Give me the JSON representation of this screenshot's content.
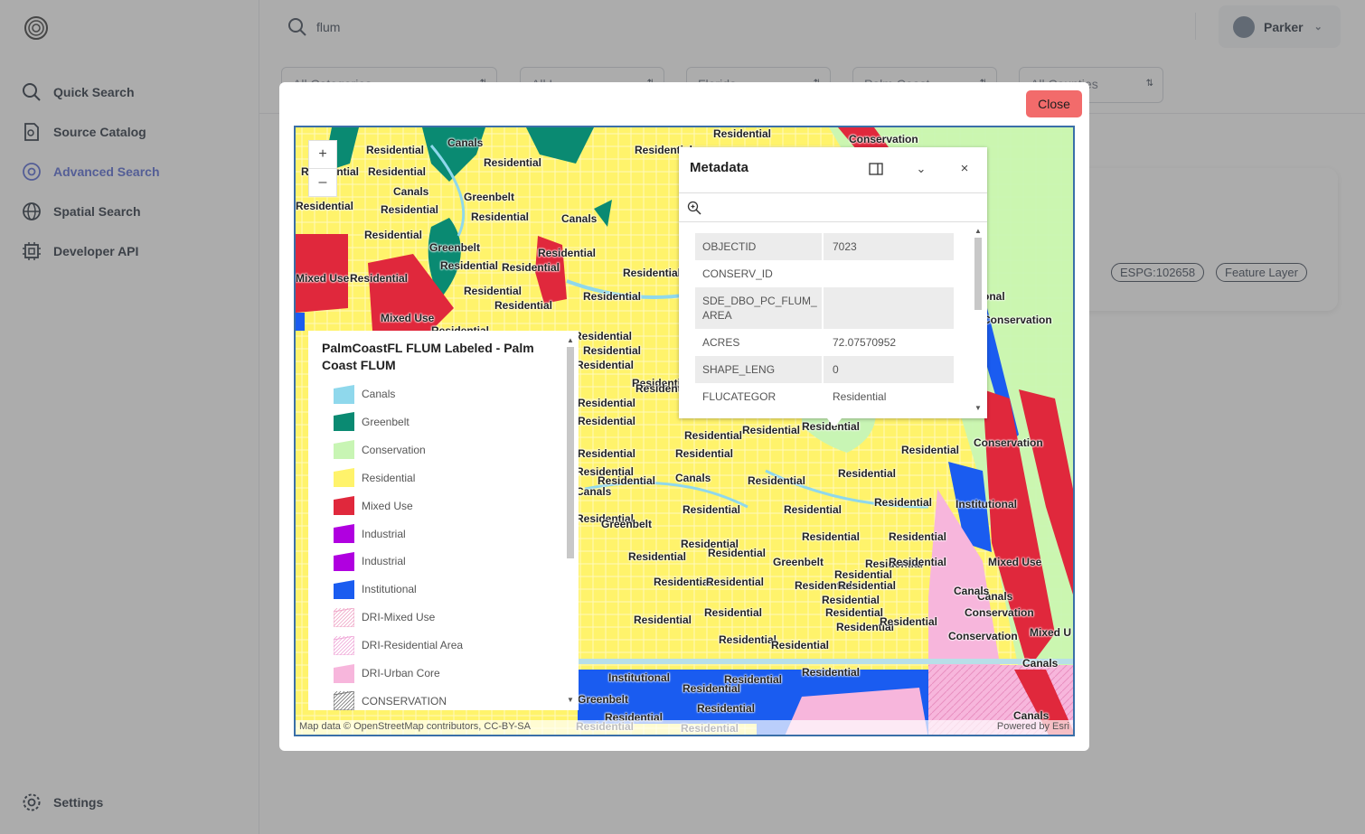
{
  "sidebar": {
    "items": [
      {
        "label": "Quick Search",
        "icon": "search-icon"
      },
      {
        "label": "Source Catalog",
        "icon": "document-icon"
      },
      {
        "label": "Advanced Search",
        "icon": "at-sign-icon",
        "active": true
      },
      {
        "label": "Spatial Search",
        "icon": "globe-icon"
      },
      {
        "label": "Developer API",
        "icon": "chip-icon"
      }
    ],
    "settings_label": "Settings"
  },
  "search": {
    "value": "flum"
  },
  "user": {
    "name": "Parker"
  },
  "filters": [
    "All Categories",
    "All L",
    "Florida",
    "Palm Coast",
    "All Counties"
  ],
  "result": {
    "tags": [
      "ESPG:102658",
      "Feature Layer"
    ]
  },
  "modal": {
    "close_label": "Close"
  },
  "map": {
    "zoom_in": "+",
    "zoom_out": "–",
    "attribution_left": "Map data © OpenStreetMap contributors, CC-BY-SA",
    "attribution_right": "Powered by Esri",
    "labels": [
      {
        "t": "Residential"
      },
      {
        "t": "Canals"
      },
      {
        "t": "Residential"
      },
      {
        "t": "Residential"
      },
      {
        "t": "Residential"
      },
      {
        "t": "Conservation"
      },
      {
        "t": "Residential"
      },
      {
        "t": "Residential"
      },
      {
        "t": "Canals"
      },
      {
        "t": "Greenbelt"
      },
      {
        "t": "Residential"
      },
      {
        "t": "Residential"
      },
      {
        "t": "Residential"
      },
      {
        "t": "Canals"
      },
      {
        "t": "Residential"
      },
      {
        "t": "Greenbelt"
      },
      {
        "t": "Residential"
      },
      {
        "t": "Residential"
      },
      {
        "t": "Residential"
      },
      {
        "t": "Residential"
      },
      {
        "t": "Mixed Use"
      },
      {
        "t": "Residential"
      },
      {
        "t": "Residential"
      },
      {
        "t": "Residential"
      },
      {
        "t": "Residential"
      },
      {
        "t": "Mixed Use"
      },
      {
        "t": "Residential"
      },
      {
        "t": "Residential"
      },
      {
        "t": "Residential"
      },
      {
        "t": "Residential"
      },
      {
        "t": "Residential"
      },
      {
        "t": "Residential"
      },
      {
        "t": "Residential"
      },
      {
        "t": "Residential"
      },
      {
        "t": "Residential"
      },
      {
        "t": "Residential"
      },
      {
        "t": "Residential"
      },
      {
        "t": "Residential"
      },
      {
        "t": "Residential"
      },
      {
        "t": "Residential"
      },
      {
        "t": "Residential"
      },
      {
        "t": "Canals"
      },
      {
        "t": "Residential"
      },
      {
        "t": "Residential"
      },
      {
        "t": "Residential"
      },
      {
        "t": "Canals"
      },
      {
        "t": "Greenbelt"
      },
      {
        "t": "Residential"
      },
      {
        "t": "Residential"
      },
      {
        "t": "Residential"
      },
      {
        "t": "Residential"
      },
      {
        "t": "Residential"
      },
      {
        "t": "Residential"
      },
      {
        "t": "Residential"
      },
      {
        "t": "Greenbelt"
      },
      {
        "t": "Residential"
      },
      {
        "t": "Residential"
      },
      {
        "t": "Residential"
      },
      {
        "t": "Residential"
      },
      {
        "t": "Residential"
      },
      {
        "t": "Residential"
      },
      {
        "t": "Residential"
      },
      {
        "t": "Residential"
      },
      {
        "t": "Residential"
      },
      {
        "t": "Residential"
      },
      {
        "t": "Residential"
      },
      {
        "t": "Residential"
      },
      {
        "t": "Residential"
      },
      {
        "t": "Residential"
      },
      {
        "t": "Institutional"
      },
      {
        "t": "Residential"
      },
      {
        "t": "Residential"
      },
      {
        "t": "Greenbelt"
      },
      {
        "t": "Residential"
      },
      {
        "t": "Residential"
      },
      {
        "t": "Canals"
      },
      {
        "t": "onal"
      },
      {
        "t": "Conservation"
      },
      {
        "t": "Conservation"
      },
      {
        "t": "Institutional"
      },
      {
        "t": "Mixed Use"
      },
      {
        "t": "Canals"
      },
      {
        "t": "Conservation"
      },
      {
        "t": "Conservation"
      },
      {
        "t": "Mixed U"
      },
      {
        "t": "Canals"
      },
      {
        "t": "Canals"
      },
      {
        "t": "Residential"
      },
      {
        "t": "Residential"
      },
      {
        "t": "Residential"
      },
      {
        "t": "Residential"
      },
      {
        "t": "Residential"
      },
      {
        "t": "Residential"
      }
    ]
  },
  "legend": {
    "title": "PalmCoastFL FLUM Labeled - Palm Coast FLUM",
    "items": [
      {
        "label": "Canals",
        "color": "#8fd8ec",
        "hatch": false
      },
      {
        "label": "Greenbelt",
        "color": "#0a8a72",
        "hatch": false
      },
      {
        "label": "Conservation",
        "color": "#c8f5b4",
        "hatch": false
      },
      {
        "label": "Residential",
        "color": "#fff36b",
        "hatch": false
      },
      {
        "label": "Mixed Use",
        "color": "#e0283c",
        "hatch": false
      },
      {
        "label": "Industrial",
        "color": "#b000e0",
        "hatch": false
      },
      {
        "label": "Industrial",
        "color": "#b000e0",
        "hatch": false
      },
      {
        "label": "Institutional",
        "color": "#1a5cf0",
        "hatch": false
      },
      {
        "label": "DRI-Mixed Use",
        "color": "#f0a8c8",
        "hatch": true
      },
      {
        "label": "DRI-Residential Area",
        "color": "#f0a8d8",
        "hatch": true
      },
      {
        "label": "DRI-Urban Core",
        "color": "#f7b6dc",
        "hatch": false
      },
      {
        "label": "CONSERVATION",
        "color": "#777777",
        "hatch": true
      }
    ]
  },
  "metadata": {
    "title": "Metadata",
    "rows": [
      {
        "key": "OBJECTID",
        "value": "7023"
      },
      {
        "key": "CONSERV_ID",
        "value": ""
      },
      {
        "key": "SDE_DBO_PC_FLUM_ AREA",
        "value": ""
      },
      {
        "key": "ACRES",
        "value": "72.07570952"
      },
      {
        "key": "SHAPE_LENG",
        "value": "0"
      },
      {
        "key": "FLUCATEGOR",
        "value": "Residential"
      }
    ]
  }
}
